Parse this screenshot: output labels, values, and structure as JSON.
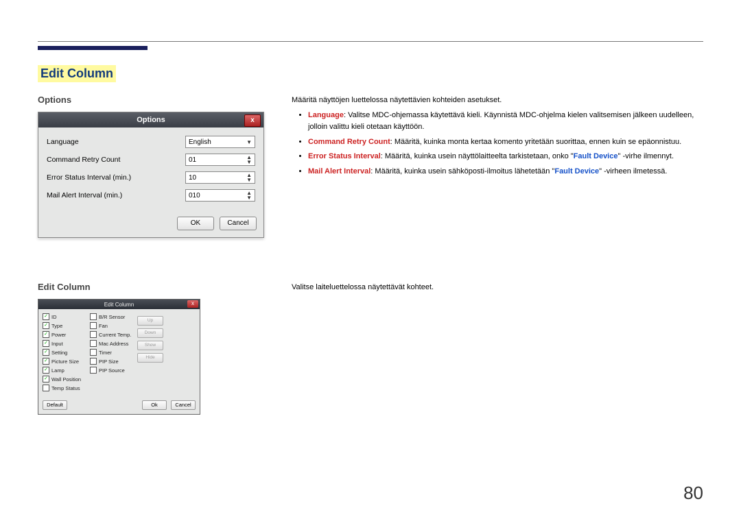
{
  "section_title": "Edit Column",
  "subhead_options": "Options",
  "subhead_editcolumn": "Edit Column",
  "intro_line": "Määritä näyttöjen luettelossa näytettävien kohteiden asetukset.",
  "bullets": {
    "language_term": "Language",
    "language_text": ": Valitse MDC-ohjemassa käytettävä kieli. Käynnistä MDC-ohjelma kielen valitsemisen jälkeen uudelleen, jolloin valittu kieli otetaan käyttöön.",
    "crc_term": "Command Retry Count",
    "crc_text": ": Määritä, kuinka monta kertaa komento yritetään suorittaa, ennen kuin se epäonnistuu.",
    "esi_term": "Error Status Interval",
    "esi_text_a": ": Määritä, kuinka usein näyttölaitteelta tarkistetaan, onko \"",
    "esi_fault": "Fault Device",
    "esi_text_b": "\" -virhe ilmennyt.",
    "mai_term": "Mail Alert Interval",
    "mai_text_a": ": Määritä, kuinka usein sähköposti-ilmoitus lähetetään \"",
    "mai_fault": "Fault Device",
    "mai_text_b": "\" -virheen ilmetessä."
  },
  "options_dialog": {
    "title": "Options",
    "close": "x",
    "rows": {
      "language_label": "Language",
      "language_value": "English",
      "crc_label": "Command Retry Count",
      "crc_value": "01",
      "esi_label": "Error Status Interval (min.)",
      "esi_value": "10",
      "mai_label": "Mail Alert Interval (min.)",
      "mai_value": "010"
    },
    "ok": "OK",
    "cancel": "Cancel"
  },
  "editcolumn_desc": "Valitse laiteluettelossa näytettävät kohteet.",
  "editcolumn_dialog": {
    "title": "Edit Column",
    "close": "x",
    "col1": [
      {
        "label": "ID",
        "checked": true
      },
      {
        "label": "Type",
        "checked": true
      },
      {
        "label": "Power",
        "checked": true
      },
      {
        "label": "Input",
        "checked": true
      },
      {
        "label": "Setting",
        "checked": true
      },
      {
        "label": "Picture Size",
        "checked": true
      },
      {
        "label": "Lamp",
        "checked": true
      },
      {
        "label": "Wall Position",
        "checked": true
      },
      {
        "label": "Temp Status",
        "checked": false
      }
    ],
    "col2": [
      {
        "label": "B/R Sensor",
        "checked": false
      },
      {
        "label": "Fan",
        "checked": false
      },
      {
        "label": "Current Temp.",
        "checked": false
      },
      {
        "label": "Mac Address",
        "checked": false
      },
      {
        "label": "Timer",
        "checked": false
      },
      {
        "label": "PIP Size",
        "checked": false
      },
      {
        "label": "PIP Source",
        "checked": false
      }
    ],
    "side": {
      "up": "Up",
      "down": "Down",
      "show": "Show",
      "hide": "Hide"
    },
    "default": "Default",
    "ok": "Ok",
    "cancel": "Cancel"
  },
  "page_number": "80"
}
